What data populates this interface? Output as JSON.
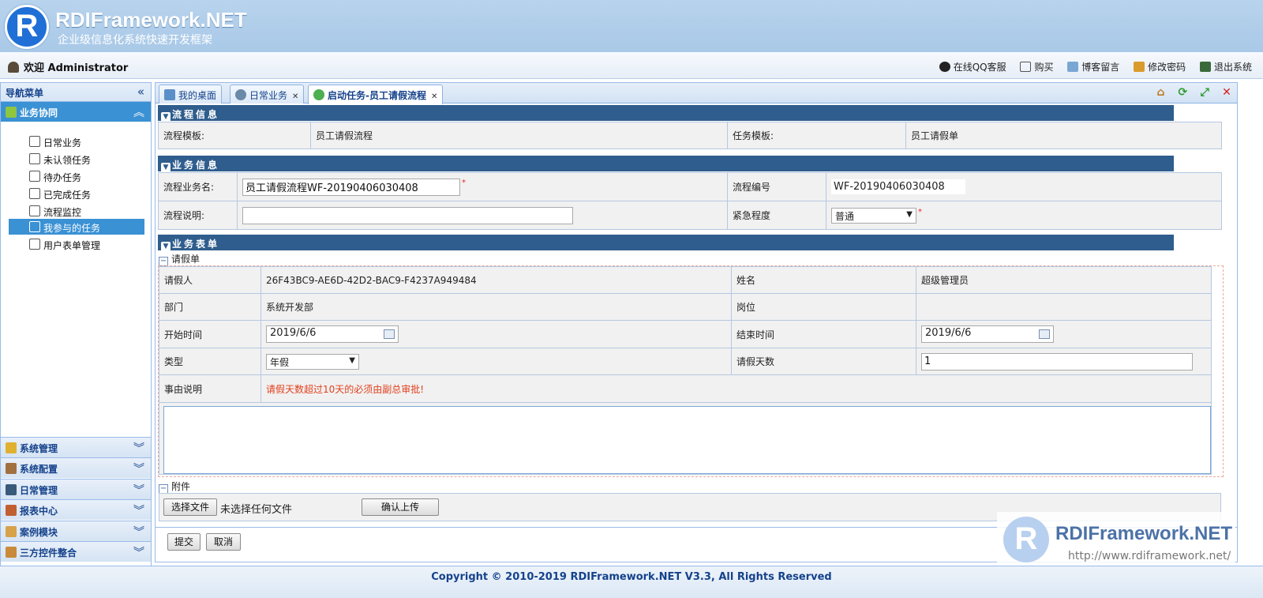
{
  "brand": {
    "logo_letter": "R",
    "title": "RDIFramework.NET",
    "subtitle": "企业级信息化系统快速开发框架"
  },
  "userbar": {
    "welcome": "欢迎 Administrator",
    "links": [
      {
        "label": "在线QQ客服",
        "icon": "qq-icon"
      },
      {
        "label": "购买",
        "icon": "cart-icon"
      },
      {
        "label": "博客留言",
        "icon": "blog-icon"
      },
      {
        "label": "修改密码",
        "icon": "key-icon"
      },
      {
        "label": "退出系统",
        "icon": "exit-icon"
      }
    ]
  },
  "sidebar": {
    "title": "导航菜单",
    "collapse_glyph": "«",
    "open_group": "业务协同",
    "items": [
      "日常业务",
      "未认领任务",
      "待办任务",
      "已完成任务",
      "流程监控",
      "我参与的任务",
      "用户表单管理"
    ],
    "selected_index": 5,
    "groups": [
      "系统管理",
      "系统配置",
      "日常管理",
      "报表中心",
      "案例模块",
      "三方控件整合"
    ]
  },
  "tabs": [
    {
      "label": "我的桌面",
      "closable": false
    },
    {
      "label": "日常业务",
      "closable": true
    },
    {
      "label": "启动任务-员工请假流程",
      "closable": true,
      "active": true
    }
  ],
  "flow_info": {
    "heading": "流程信息",
    "template_label": "流程模板:",
    "template_value": "员工请假流程",
    "task_label": "任务模板:",
    "task_value": "员工请假单"
  },
  "business_info": {
    "heading": "业务信息",
    "name_label": "流程业务名:",
    "name_value": "员工请假流程WF-20190406030408",
    "code_label": "流程编号",
    "code_value": "WF-20190406030408",
    "desc_label": "流程说明:",
    "desc_value": "",
    "urgency_label": "紧急程度",
    "urgency_value": "普通",
    "required_mark": "*"
  },
  "business_form": {
    "heading": "业务表单",
    "subheading": "请假单",
    "applicant_label": "请假人",
    "applicant_value": "26F43BC9-AE6D-42D2-BAC9-F4237A949484",
    "name_label": "姓名",
    "name_value": "超级管理员",
    "dept_label": "部门",
    "dept_value": "系统开发部",
    "post_label": "岗位",
    "post_value": "",
    "start_label": "开始时间",
    "start_value": "2019/6/6",
    "end_label": "结束时间",
    "end_value": "2019/6/6",
    "type_label": "类型",
    "type_value": "年假",
    "days_label": "请假天数",
    "days_value": "1",
    "reason_label": "事由说明",
    "reason_note": "请假天数超过10天的必须由副总审批!",
    "reason_text": ""
  },
  "attachment": {
    "heading": "附件",
    "choose_btn": "选择文件",
    "no_file": "未选择任何文件",
    "upload_btn": "确认上传"
  },
  "actions": {
    "submit": "提交",
    "cancel": "取消"
  },
  "footer": {
    "copyright": "Copyright © 2010-2019 RDIFramework.NET V3.3, All Rights Reserved"
  },
  "watermark": {
    "title": "RDIFramework.NET",
    "url": "http://www.rdiframework.net/"
  },
  "colors": {
    "header_bg": "#aecbe9",
    "accent": "#3a91d4",
    "section_head": "#2f5d8d",
    "required": "#ee2222",
    "note": "#e2401c"
  }
}
